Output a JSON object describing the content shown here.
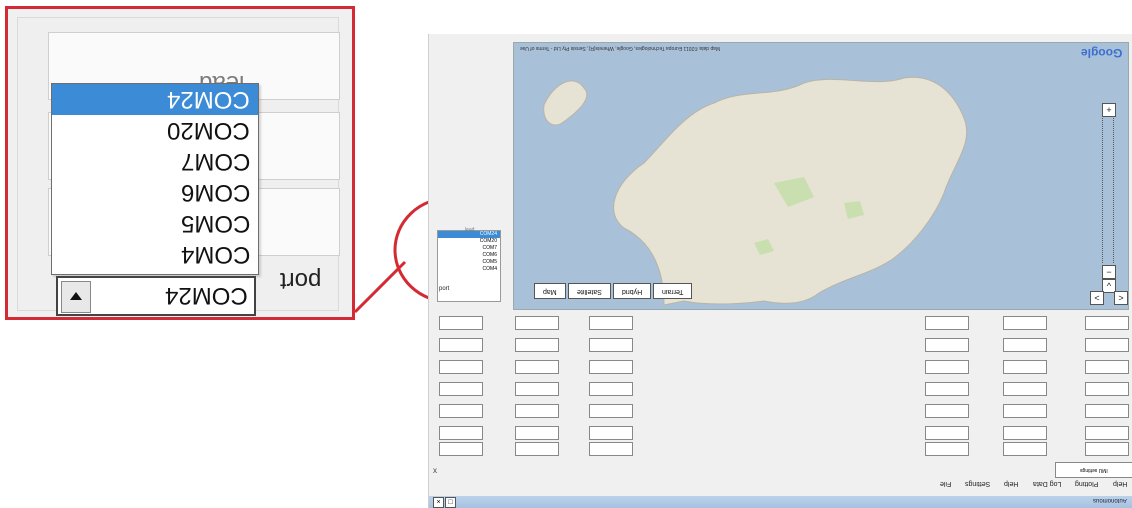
{
  "callout": {
    "lead_label": "lead",
    "port_label": "port",
    "selected_port": "COM24",
    "ports": [
      "COM24",
      "COM20",
      "COM7",
      "COM6",
      "COM5",
      "COM4"
    ]
  },
  "app": {
    "map_caption": "Map data ©2011 Europa Technologies, Google, Whereis(R), Sensis Pty Ltd - Terms of Use",
    "brand": "Google",
    "map_types": [
      "Map",
      "Satellite",
      "Hybrid",
      "Terrain"
    ],
    "mini_items": [
      "COM24",
      "COM20",
      "COM7",
      "COM6",
      "COM5",
      "COM4"
    ],
    "mini_port": "port",
    "mini_lead": "lead",
    "tab_label": "IMU settings",
    "menu": [
      "File",
      "Settings",
      "Help",
      "Log Data",
      "Plotting",
      "Help"
    ],
    "title": "Autonomous",
    "close_label": "x"
  },
  "colors": {
    "accent": "#d42a33",
    "selection": "#3b8bd6",
    "map_water": "#a9c0d9"
  }
}
